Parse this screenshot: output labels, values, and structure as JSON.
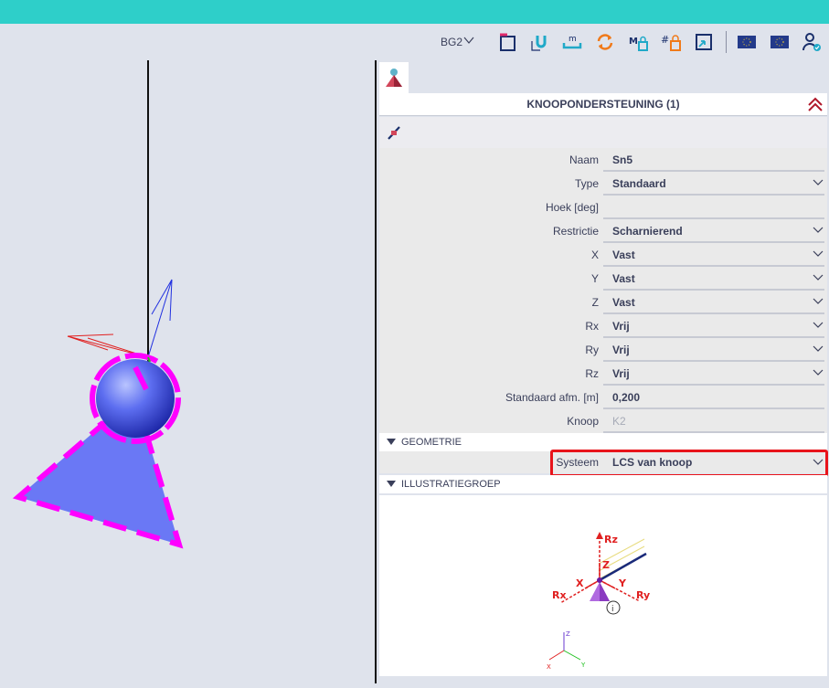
{
  "toolbar": {
    "workspace_label": "BG2",
    "icons": [
      "support-icon",
      "axis-u-icon",
      "dimension-m-icon",
      "refresh-icon",
      "lock-m-icon",
      "lock-grid-icon",
      "zoom-window-icon",
      "flag-icon",
      "flag-icon",
      "user-check-icon"
    ]
  },
  "panel": {
    "header_title": "KNOOPONDERSTEUNING (1)",
    "properties": [
      {
        "label": "Naam",
        "value": "Sn5"
      },
      {
        "label": "Type",
        "value": "Standaard"
      },
      {
        "label": "Hoek [deg]",
        "value": ""
      },
      {
        "label": "Restrictie",
        "value": "Scharnierend"
      },
      {
        "label": "X",
        "value": "Vast"
      },
      {
        "label": "Y",
        "value": "Vast"
      },
      {
        "label": "Z",
        "value": "Vast"
      },
      {
        "label": "Rx",
        "value": "Vrij"
      },
      {
        "label": "Ry",
        "value": "Vrij"
      },
      {
        "label": "Rz",
        "value": "Vrij"
      },
      {
        "label": "Standaard afm. [m]",
        "value": "0,200"
      },
      {
        "label": "Knoop",
        "value": "K2"
      }
    ],
    "geometry_section": "GEOMETRIE",
    "system_label": "Systeem",
    "system_value": "LCS van knoop",
    "illustration_section": "ILLUSTRATIEGROEP",
    "illustration_labels": {
      "rz": "Rz",
      "z": "Z",
      "x": "X",
      "y": "Y",
      "rx": "Rx",
      "ry": "Ry",
      "info": "i"
    },
    "axis_triad": {
      "z": "Z",
      "x": "X",
      "y": "Y"
    }
  },
  "colors": {
    "topbar": "#2ecfc9",
    "highlight": "#e8141b",
    "selection": "#ff00ff",
    "support_fill": "#6a78f5"
  }
}
